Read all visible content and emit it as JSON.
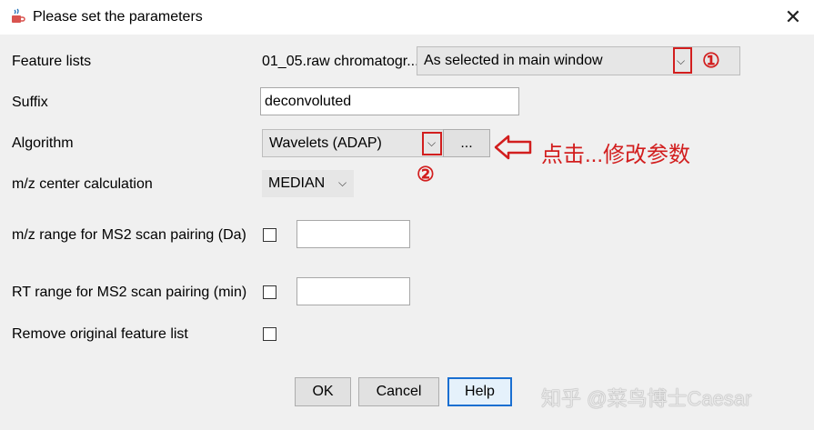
{
  "window": {
    "title": "Please set the parameters"
  },
  "labels": {
    "feature_lists": "Feature lists",
    "suffix": "Suffix",
    "algorithm": "Algorithm",
    "mz_center": "m/z center calculation",
    "mz_range_ms2": "m/z range for MS2 scan pairing (Da)",
    "rt_range_ms2": "RT range for MS2 scan pairing (min)",
    "remove_original": "Remove original feature list"
  },
  "fields": {
    "feature_lists_value": "01_05.raw chromatogr...",
    "feature_lists_combo": "As selected in main window",
    "suffix_value": "deconvoluted",
    "algorithm_combo": "Wavelets (ADAP)",
    "algorithm_setup_button": "...",
    "mz_center_combo": "MEDIAN",
    "mz_range_value": "",
    "rt_range_value": ""
  },
  "buttons": {
    "ok": "OK",
    "cancel": "Cancel",
    "help": "Help"
  },
  "annotations": {
    "marker_1": "①",
    "marker_2": "②",
    "hint_text": "点击...修改参数",
    "watermark": "知乎 @菜鸟博士Caesar"
  },
  "colors": {
    "annotation_red": "#d21e1e",
    "window_bg": "#f0f0f0"
  }
}
